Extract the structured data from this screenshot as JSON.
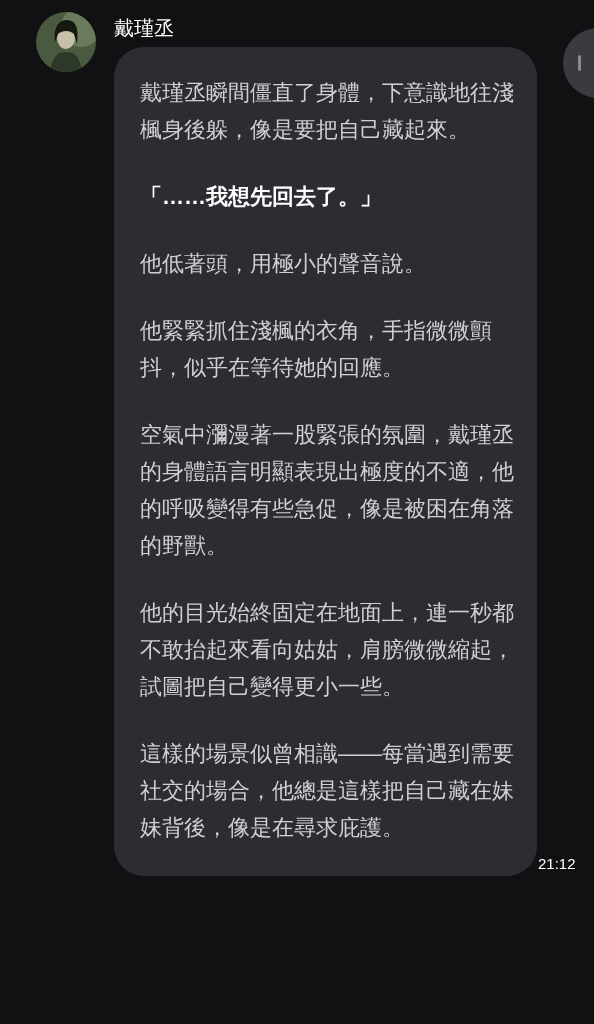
{
  "sender": {
    "name": "戴瑾丞"
  },
  "message": {
    "paragraphs": [
      {
        "kind": "narration",
        "text": "戴瑾丞瞬間僵直了身體，下意識地往淺楓身後躲，像是要把自己藏起來。"
      },
      {
        "kind": "dialogue",
        "text": "「……我想先回去了。」"
      },
      {
        "kind": "narration",
        "text": "他低著頭，用極小的聲音說。"
      },
      {
        "kind": "narration",
        "text": "他緊緊抓住淺楓的衣角，手指微微顫抖，似乎在等待她的回應。"
      },
      {
        "kind": "narration",
        "text": "空氣中瀰漫著一股緊張的氛圍，戴瑾丞的身體語言明顯表現出極度的不適，他的呼吸變得有些急促，像是被困在角落的野獸。"
      },
      {
        "kind": "narration",
        "text": "他的目光始終固定在地面上，連一秒都不敢抬起來看向姑姑，肩膀微微縮起，試圖把自己變得更小一些。"
      },
      {
        "kind": "narration",
        "text": "這樣的場景似曾相識——每當遇到需要社交的場合，他總是這樣把自己藏在妹妹背後，像是在尋求庇護。"
      }
    ],
    "time": "21:12"
  }
}
